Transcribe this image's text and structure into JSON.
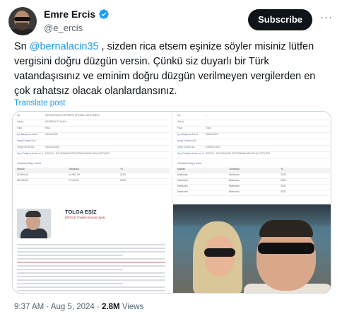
{
  "author": {
    "name": "Emre Ercis",
    "handle": "@e_ercis"
  },
  "header": {
    "subscribe_label": "Subscribe",
    "more_label": "···"
  },
  "tweet": {
    "text_before_mention": "Sn ",
    "mention": "@bernalacin35",
    "text_after_mention": " , sizden rica etsem eşinize söyler misiniz lütfen vergisini doğru düzgün versin. Çünkü siz duyarlı bir Türk vatandaşısınız ve eminim doğru düzgün verilmeyen vergilerden en çok rahatsız olacak olanlardansınız.",
    "translate_label": "Translate post"
  },
  "meta": {
    "time": "9:37 AM",
    "sep1": " · ",
    "date": "Aug 5, 2024",
    "sep2": " · ",
    "views": "2.8M",
    "views_label": " Views"
  },
  "media": {
    "doc_left": {
      "rows": [
        {
          "k": "Ad",
          "v": "ZEHRA GENÇ DERNEĞİ İKTİSADİ İŞLETMESİ"
        },
        {
          "k": "Adres",
          "v": "KEMERALTI MAH. ..."
        },
        {
          "k": "Faal",
          "v": "Faal"
        },
        {
          "k": "İşe Başlama Tarihi",
          "v": "26/06/2009"
        },
        {
          "k": "Vergi Dairesi Adı",
          "v": "..."
        },
        {
          "k": "Vergi Kimlik No",
          "v": "3900424190"
        },
        {
          "k": "Ana Faaliyet Kodu ve Adı",
          "v": "620101 - BİLGİSAYAR PROGRAMLAMA FAALİYETLERİ"
        }
      ],
      "subhead": "Tahakkuk Bilgi Listesi",
      "table_head": [
        "Matrah",
        "Tahakkuk",
        "Yıl"
      ],
      "table_rows": [
        [
          "57.999,00",
          "14.997,00",
          "2023"
        ],
        [
          "36.006,00",
          "8.743,00",
          "2022"
        ]
      ]
    },
    "doc_right": {
      "rows": [
        {
          "k": "Ad",
          "v": "..."
        },
        {
          "k": "Adres",
          "v": "..."
        },
        {
          "k": "Faal",
          "v": "Faal"
        },
        {
          "k": "İşe Başlama Tarihi",
          "v": "08/09/2009"
        },
        {
          "k": "Vergi Dairesi Adı",
          "v": "..."
        },
        {
          "k": "Vergi Kimlik No",
          "v": "2930001410"
        },
        {
          "k": "Ana Faaliyet Kodu ve Adı",
          "v": "620101 - BİLGİSAYAR PROGRAMLAMA FAALİYETLERİ"
        }
      ],
      "subhead": "Tahakkuk Bilgi Listesi",
      "table_head": [
        "Matrah",
        "Tahakkuk",
        "Yıl"
      ],
      "table_rows": [
        [
          "Mahsubu",
          "Mahsubu",
          "2023"
        ],
        [
          "Mahsubu",
          "Mahsubu",
          "2022"
        ],
        [
          "Mahsubu",
          "Mahsubu",
          "2021"
        ],
        [
          "Mahsubu",
          "Mahsubu",
          "2020"
        ]
      ]
    },
    "profile": {
      "name": "TOLGA EŞİZ",
      "role": "DOĞUŞ Yönetim Kurulu Üyesi"
    }
  },
  "colors": {
    "accent": "#1d9bf0",
    "text": "#0f1419",
    "muted": "#536471"
  }
}
